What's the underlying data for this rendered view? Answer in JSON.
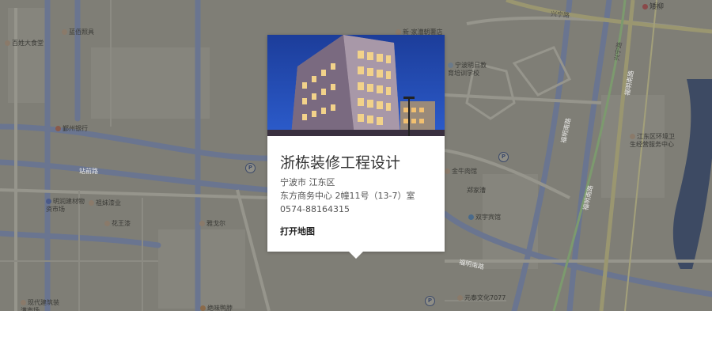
{
  "popup": {
    "title": "浙栋装修工程设计",
    "district": "宁波市 江东区",
    "address": "东方商务中心 2幢11号（13-7）室",
    "phone": "0574-88164315",
    "map_link": "打开地图"
  },
  "map_labels": {
    "yinzhou_tower": "百姓大食堂",
    "lanbai": "蓝佰照具",
    "yinzhou_bank": "鄞州银行",
    "zhanqian_road": "站前路",
    "mingrun": "明润建材物资市场",
    "zumei": "祖妹漆业",
    "huawang": "花王漆",
    "yage": "雅戈尔",
    "xiandai": "现代建筑装潢市场",
    "xingning_road": "兴宁路",
    "xingning_road2": "兴宁路",
    "fumin_south": "福明南路",
    "fumin_south2": "福明南路",
    "fumin_road": "福明南路",
    "yangfang": "宁波明日教育培训学校",
    "jiangdong_env": "江东区环境卫生经营服务中心",
    "shengtai": "双宇宾馆",
    "zhengxiang": "郑家漕",
    "yinfeng": "元泰文化7077",
    "juehua": "绝味鸭脖",
    "fumin_road_bottom": "福明南路",
    "xinhua": "金牛肉馆",
    "top_right": "矮柳",
    "top_center": "新·家漕朝薯店"
  }
}
